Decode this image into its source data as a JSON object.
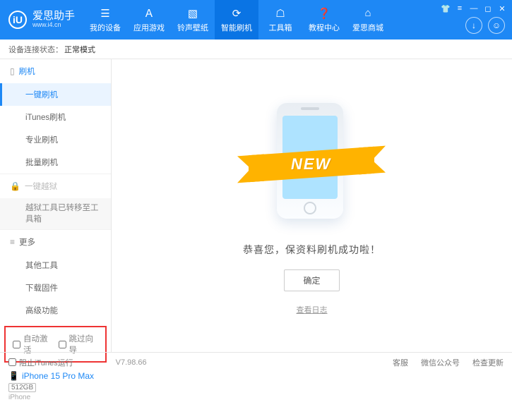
{
  "brand": {
    "name": "爱思助手",
    "url": "www.i4.cn",
    "logo_letter": "iU"
  },
  "nav": [
    {
      "label": "我的设备",
      "glyph": "☰"
    },
    {
      "label": "应用游戏",
      "glyph": "Ａ"
    },
    {
      "label": "铃声壁纸",
      "glyph": "▧"
    },
    {
      "label": "智能刷机",
      "glyph": "⟳",
      "active": true
    },
    {
      "label": "工具箱",
      "glyph": "☖"
    },
    {
      "label": "教程中心",
      "glyph": "❓"
    },
    {
      "label": "爱思商城",
      "glyph": "⌂"
    }
  ],
  "status": {
    "label": "设备连接状态：",
    "value": "正常模式"
  },
  "sidebar": {
    "g1_head": "刷机",
    "g1_items": [
      {
        "label": "一键刷机",
        "active": true
      },
      {
        "label": "iTunes刷机"
      },
      {
        "label": "专业刷机"
      },
      {
        "label": "批量刷机"
      }
    ],
    "g2_head": "一键越狱",
    "g2_note": "越狱工具已转移至工具箱",
    "g3_head": "更多",
    "g3_items": [
      {
        "label": "其他工具"
      },
      {
        "label": "下载固件"
      },
      {
        "label": "高级功能"
      }
    ],
    "checks": {
      "auto_activate": "自动激活",
      "skip_guide": "跳过向导"
    }
  },
  "device": {
    "name": "iPhone 15 Pro Max",
    "storage": "512GB",
    "type": "iPhone"
  },
  "main": {
    "ribbon": "NEW",
    "success": "恭喜您，保资料刷机成功啦！",
    "ok": "确定",
    "viewlog": "查看日志"
  },
  "footer": {
    "block_itunes": "阻止iTunes运行",
    "version": "V7.98.66",
    "kefu": "客服",
    "wechat": "微信公众号",
    "update": "检查更新"
  }
}
